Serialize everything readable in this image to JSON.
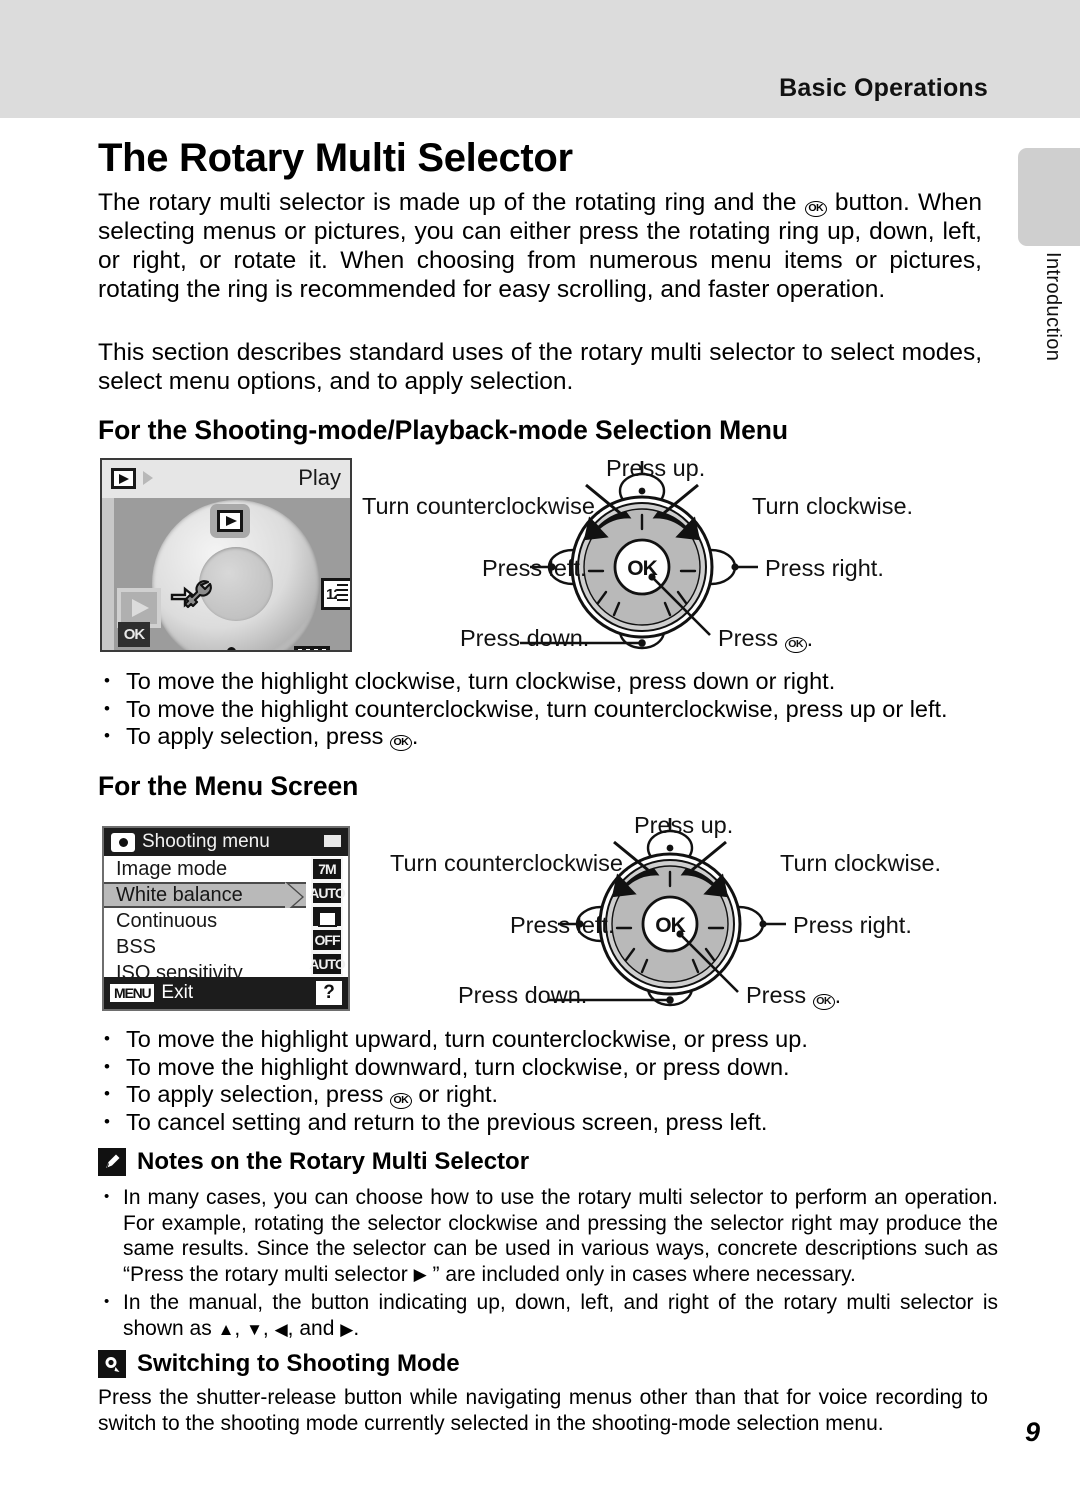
{
  "header": {
    "title": "Basic Operations"
  },
  "side_tab": {
    "label": "Introduction"
  },
  "page_number": "9",
  "doc": {
    "title": "The Rotary Multi Selector",
    "para_1_a": "The rotary multi selector is made up of the rotating ring and the",
    "para_1_b": "button. When selecting menus or pictures, you can either press the rotating ring up, down, left, or right, or rotate it. When choosing from numerous menu items or pictures, rotating the ring is recommended for easy scrolling, and faster operation.",
    "para_2": "This section describes standard uses of the rotary multi selector to select modes, select menu options, and to apply selection."
  },
  "section_1": {
    "heading": "For the Shooting-mode/Playback-mode Selection Menu",
    "bullets": [
      "To move the highlight clockwise, turn clockwise, press down or right.",
      "To move the highlight counterclockwise, turn counterclockwise, press up or left."
    ],
    "bullet_ok_prefix": "To apply selection, press",
    "bullet_ok_suffix": "."
  },
  "section_2": {
    "heading": "For the Menu Screen",
    "bullets": [
      "To move the highlight upward, turn counterclockwise, or press up.",
      "To move the highlight downward, turn clockwise, or press down."
    ],
    "bullet_ok_prefix": "To apply selection, press",
    "bullet_ok_suffix": "or right.",
    "bullet_last": "To cancel setting and return to the previous screen, press left."
  },
  "rotary_labels": {
    "press_up": "Press up.",
    "turn_ccw": "Turn counterclockwise.",
    "turn_cw": "Turn clockwise.",
    "press_left": "Press left.",
    "press_right": "Press right.",
    "press_down": "Press down.",
    "press_ok_prefix": "Press",
    "press_ok_suffix": ".",
    "ok_text": "OK"
  },
  "screen_playback": {
    "mode_label": "Play",
    "ok_badge": "OK",
    "icons": [
      "play-icon",
      "setup-wrench-icon",
      "calendar-icon",
      "voice-playback-icon",
      "date-icon"
    ]
  },
  "screen_menu": {
    "title": "Shooting menu",
    "rows": [
      {
        "label": "Image mode",
        "value": "7M",
        "highlight": false
      },
      {
        "label": "White balance",
        "value": "AUTO",
        "highlight": true
      },
      {
        "label": "Continuous",
        "value": "",
        "highlight": false
      },
      {
        "label": "BSS",
        "value": "OFF",
        "highlight": false
      },
      {
        "label": "ISO sensitivity",
        "value": "AUTO",
        "highlight": false
      }
    ],
    "bottom_chip": "MENU",
    "bottom_label": "Exit",
    "help_chip": "?"
  },
  "notes": {
    "heading": "Notes on the Rotary Multi Selector",
    "bullet_1_a": "In many cases, you can choose how to use the rotary multi selector to perform an operation. For example, rotating the selector clockwise and pressing the selector right may produce the same results. Since the selector can be used in various ways, concrete descriptions such as “Press the rotary multi selector",
    "bullet_1_b": "” are included only in cases where necessary.",
    "bullet_2_a": "In the manual, the button indicating up, down, left, and right of the rotary multi selector is shown as",
    "bullet_2_sep1": ",",
    "bullet_2_sep2": ",",
    "bullet_2_sep3": ", and",
    "bullet_2_end": "."
  },
  "switching": {
    "heading": "Switching to Shooting Mode",
    "body": "Press the shutter-release button while navigating menus other than that for voice recording to switch to the shooting mode currently selected in the shooting-mode selection menu."
  }
}
